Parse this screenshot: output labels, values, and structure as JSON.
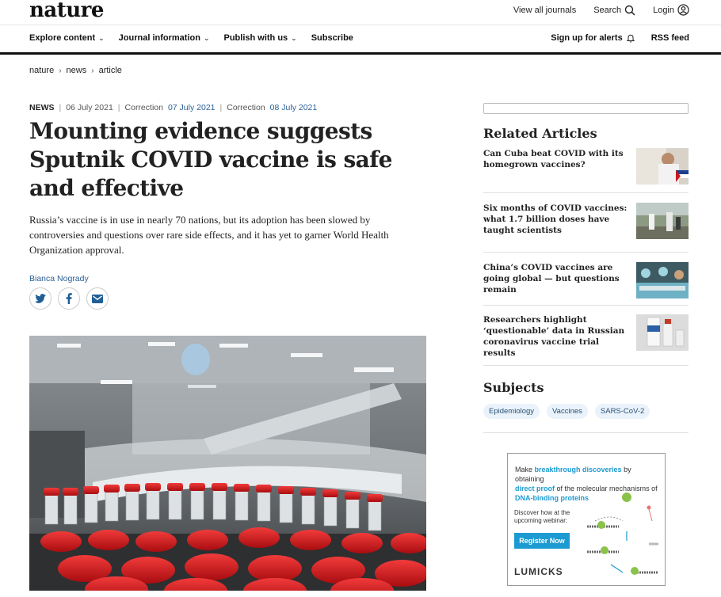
{
  "header": {
    "logo": "nature",
    "top_links": {
      "view_all": "View all journals",
      "search": "Search",
      "login": "Login"
    },
    "nav_left": [
      "Explore content",
      "Journal information",
      "Publish with us",
      "Subscribe"
    ],
    "nav_right": {
      "alerts": "Sign up for alerts",
      "rss": "RSS feed"
    }
  },
  "breadcrumb": [
    "nature",
    "news",
    "article"
  ],
  "article": {
    "type": "NEWS",
    "date": "06 July 2021",
    "correction1_label": "Correction",
    "correction1_date": "07 July 2021",
    "correction2_label": "Correction",
    "correction2_date": "08 July 2021",
    "title": "Mounting evidence suggests Sputnik COVID vaccine is safe and effective",
    "standfirst": "Russia’s vaccine is in use in nearly 70 nations, but its adoption has been slowed by controversies and questions over rare side effects, and it has yet to garner World Health Organization approval.",
    "author": "Bianca Nogrady",
    "share_icons": [
      "twitter-icon",
      "facebook-icon",
      "email-icon"
    ]
  },
  "sidebar": {
    "related_heading": "Related Articles",
    "related": [
      {
        "title": "Can Cuba beat COVID with its homegrown vaccines?"
      },
      {
        "title": "Six months of COVID vaccines: what 1.7 billion doses have taught scientists"
      },
      {
        "title": "China’s COVID vaccines are going global — but questions remain"
      },
      {
        "title": "Researchers highlight ‘questionable’ data in Russian coronavirus vaccine trial results"
      }
    ],
    "subjects_heading": "Subjects",
    "subjects": [
      "Epidemiology",
      "Vaccines",
      "SARS-CoV-2"
    ]
  },
  "ad": {
    "line1_a": "Make ",
    "line1_b": "breakthrough discoveries",
    "line1_c": " by obtaining",
    "line2_a": "direct proof",
    "line2_b": " of the molecular mechanisms of",
    "line3": "DNA-binding proteins",
    "webinar": "Discover how at the upcoming webinar:",
    "button": "Register Now",
    "brand": "LUMICKS"
  },
  "colors": {
    "link_blue": "#2a6099",
    "ad_blue": "#1b9bd1",
    "tag_bg": "#eaf3fb",
    "vial_red": "#d0181a"
  }
}
